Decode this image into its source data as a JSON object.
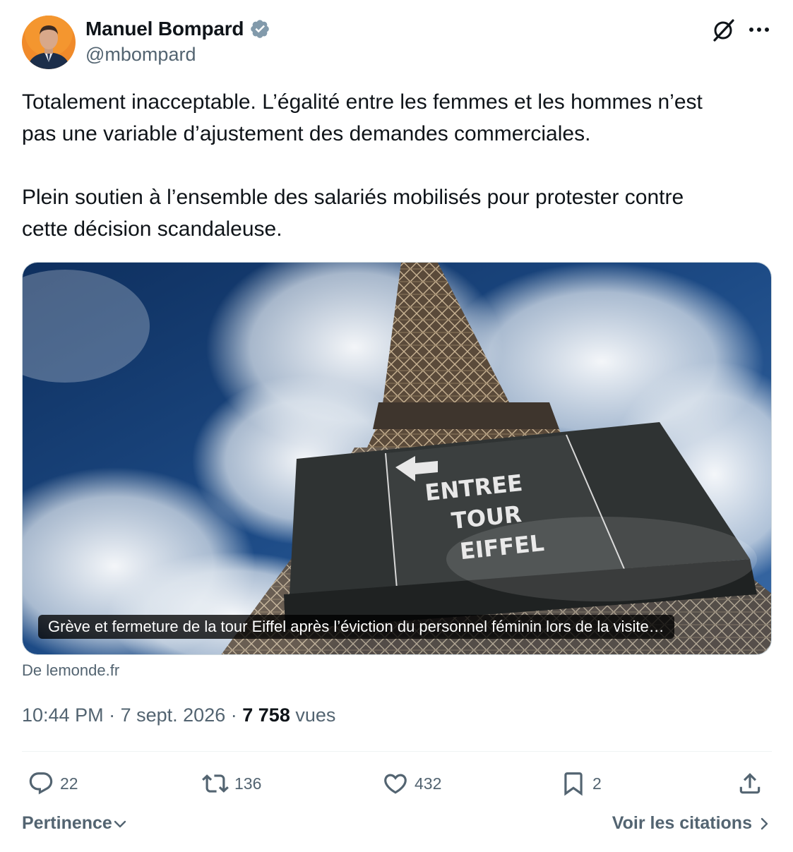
{
  "author": {
    "display_name": "Manuel Bompard",
    "handle": "@mbompard",
    "verified_icon": "verified-badge-icon"
  },
  "tweet": {
    "lines": [
      "Totalement inacceptable. L’égalité entre les femmes et les hommes n’est",
      "pas une variable d’ajustement des demandes commerciales.",
      "Plein soutien à l’ensemble des salariés mobilisés pour protester contre",
      "cette décision scandaleuse."
    ]
  },
  "card": {
    "caption": "Grève et fermeture de la tour Eiffel après l’éviction du personnel féminin lors de la visite…",
    "sign_line1": "ENTREE",
    "sign_line2": "TOUR",
    "sign_line3": "EIFFEL",
    "source": "De lemonde.fr"
  },
  "meta": {
    "time": "10:44 PM",
    "sep1": "·",
    "date": "7 sept. 2026",
    "sep2": "·",
    "views_count": "7 758",
    "views_label": "vues"
  },
  "actions": {
    "reply_count": "22",
    "retweet_count": "136",
    "like_count": "432",
    "bookmark_count": "2"
  },
  "footer": {
    "sort_label": "Pertinence",
    "quotes_label": "Voir les citations"
  },
  "colors": {
    "text_primary": "#0f1419",
    "text_secondary": "#536471",
    "divider": "#eff3f4",
    "verified": "#829aab"
  }
}
